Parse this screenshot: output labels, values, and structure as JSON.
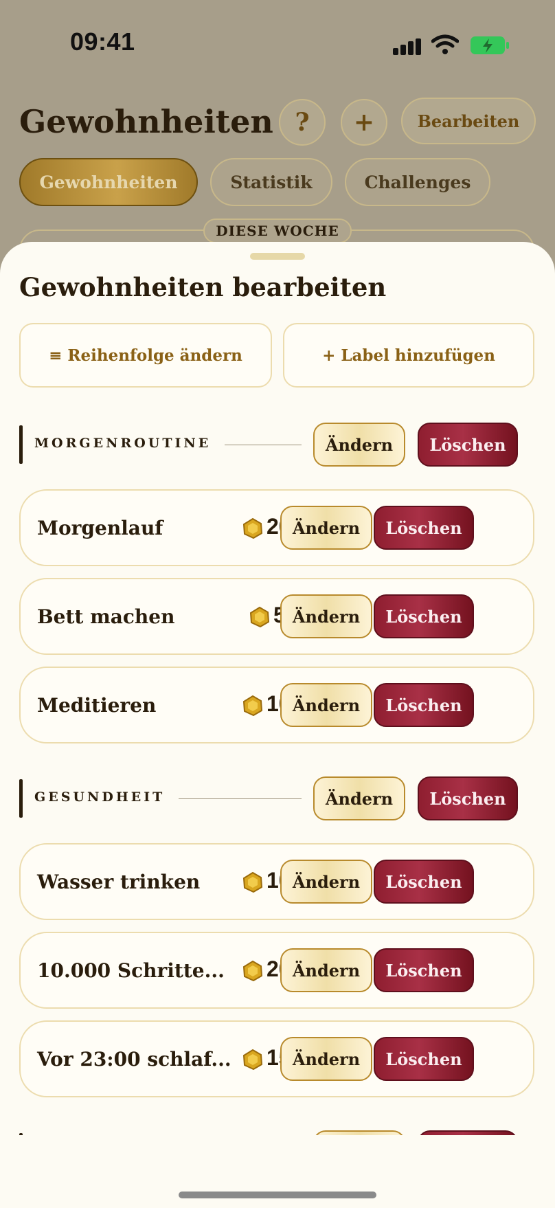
{
  "status_bar": {
    "time": "09:41"
  },
  "background": {
    "title": "Gewohnheiten",
    "help_label": "?",
    "add_label": "+",
    "edit_label": "Bearbeiten",
    "tabs": [
      {
        "label": "Gewohnheiten",
        "active": true
      },
      {
        "label": "Statistik",
        "active": false
      },
      {
        "label": "Challenges",
        "active": false
      }
    ],
    "week_label": "DIESE WOCHE"
  },
  "sheet": {
    "title": "Gewohnheiten bearbeiten",
    "reorder_label": "≡ Reihenfolge ändern",
    "add_label_label": "+ Label hinzufügen",
    "edit_button_label": "Ändern",
    "delete_button_label": "Löschen",
    "sections": [
      {
        "name": "MORGENROUTINE",
        "habits": [
          {
            "name": "Morgenlauf",
            "points": "20"
          },
          {
            "name": "Bett machen",
            "points": "5"
          },
          {
            "name": "Meditieren",
            "points": "10"
          }
        ]
      },
      {
        "name": "GESUNDHEIT",
        "habits": [
          {
            "name": "Wasser trinken",
            "points": "10"
          },
          {
            "name": "10.000 Schritte...",
            "points": "20"
          },
          {
            "name": "Vor 23:00 schlaf...",
            "points": "15"
          }
        ]
      }
    ]
  },
  "colors": {
    "accent_gold": "#8a6116",
    "delete_red": "#8f1e30",
    "text_dark": "#2a1d0c"
  }
}
